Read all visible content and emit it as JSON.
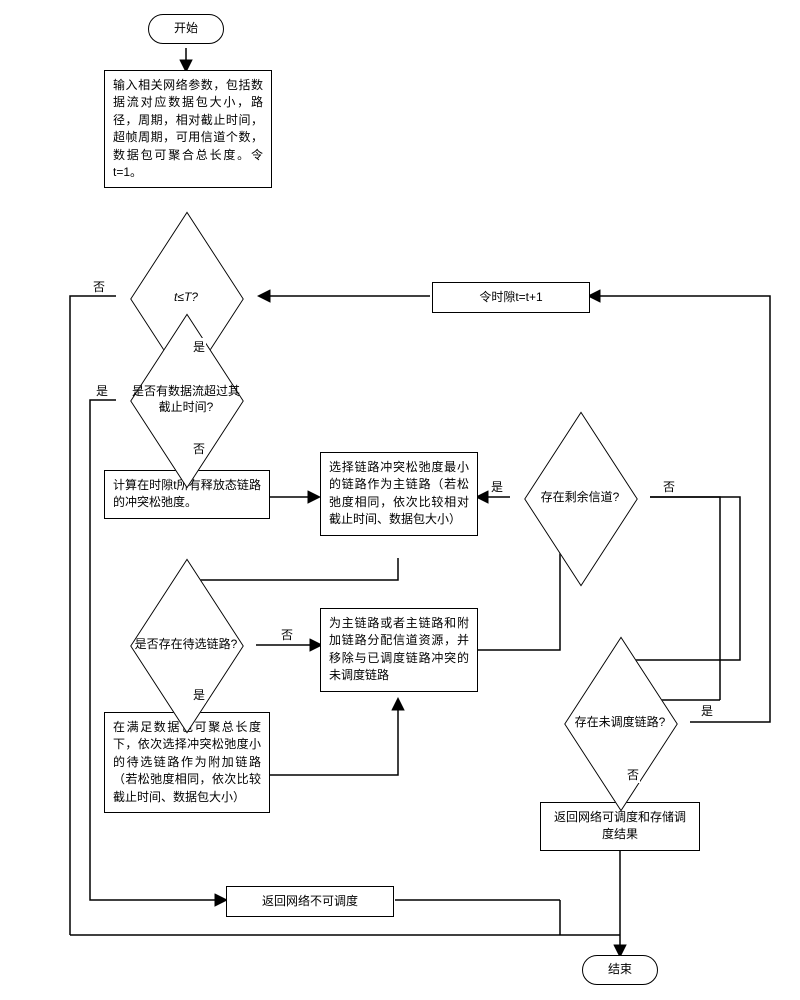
{
  "terminals": {
    "start": "开始",
    "end": "结束"
  },
  "boxes": {
    "input_params": "输入相关网络参数，包括数据流对应数据包大小，路径，周期，相对截止时间，超帧周期，可用信道个数，数据包可聚合总长度。令t=1。",
    "increment_t": "令时隙t=t+1",
    "calc_slack": "计算在时隙t所有释放态链路的冲突松弛度。",
    "select_main": "选择链路冲突松弛度最小的链路作为主链路（若松弛度相同，依次比较相对截止时间、数据包大小）",
    "assign_channel": "为主链路或者主链路和附加链路分配信道资源，并移除与已调度链路冲突的未调度链路",
    "select_attach": "在满足数据包可聚总长度下，依次选择冲突松弛度小的待选链路作为附加链路（若松弛度相同，依次比较截止时间、数据包大小）",
    "return_ok": "返回网络可调度和存储调度结果",
    "return_fail": "返回网络不可调度"
  },
  "decisions": {
    "t_le_T": "t≤T?",
    "deadline_exceeded": "是否有数据流超过其截止时间?",
    "has_candidate": "是否存在待选链路?",
    "remain_channel": "存在剩余信道?",
    "remain_unscheduled": "存在未调度链路?"
  },
  "labels": {
    "yes": "是",
    "no": "否"
  }
}
